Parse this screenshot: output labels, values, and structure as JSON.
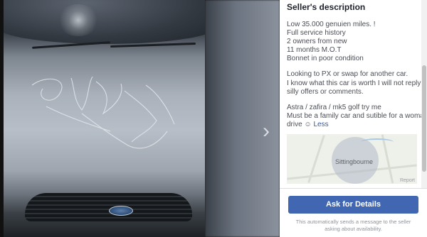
{
  "listing": {
    "heading": "Seller's description",
    "description_lines": [
      "Low 35.000 genuien miles. !",
      "Full service history",
      "2 owners from new",
      "11 months M.O.T",
      "Bonnet in poor condition"
    ],
    "paragraph2_lines": [
      "Looking to PX or swap for another car.",
      "I know what this car is worth I will not reply to",
      "silly offers or comments."
    ],
    "paragraph3_lines": [
      "Astra / zafira / mk5 golf  try me",
      "Must be a family car and sutible for a woman"
    ],
    "last_line": "drive ",
    "emoji_glyph": "☺",
    "less_link": "Less"
  },
  "map": {
    "place": "Sittingbourne",
    "legal": "Report"
  },
  "actions": {
    "ask_label": "Ask for Details",
    "note": "This automatically sends a message to the seller asking about availability."
  },
  "viewer": {
    "next_glyph": "›"
  },
  "colors": {
    "accent": "#4267b2",
    "link": "#385898"
  }
}
